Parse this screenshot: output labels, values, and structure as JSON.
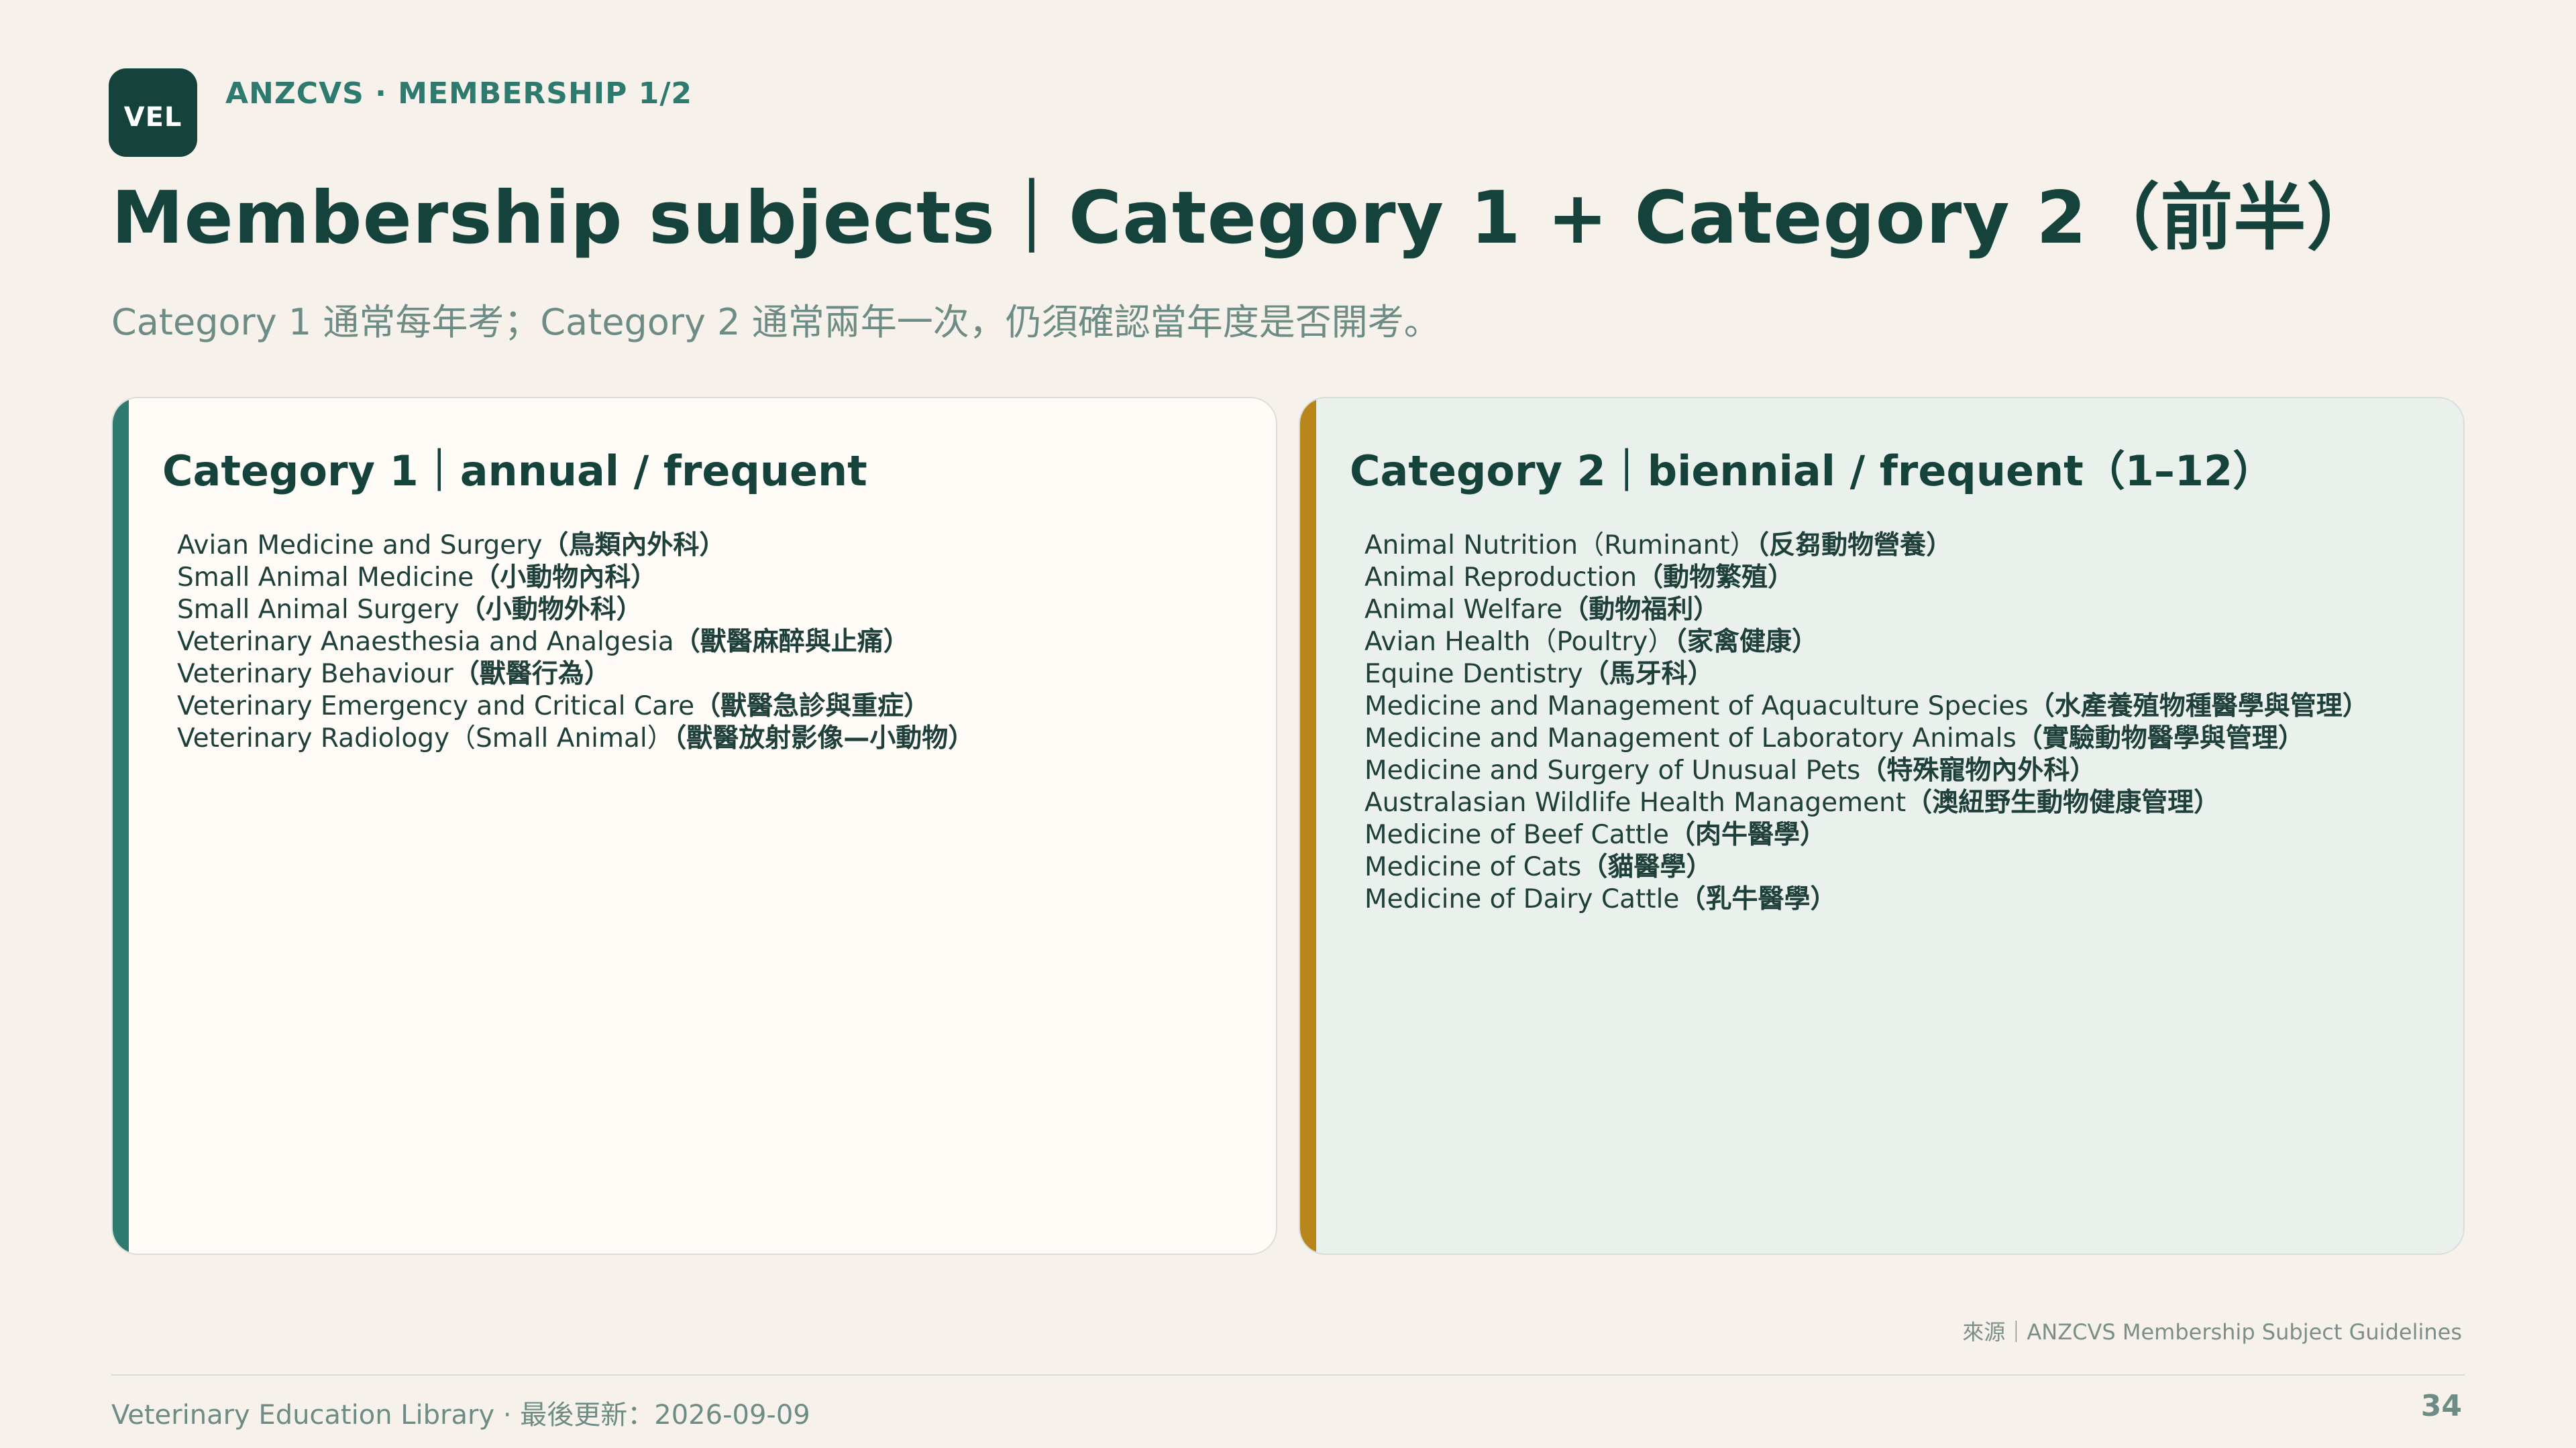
{
  "brand": {
    "logo_text": "VEL",
    "kicker": "ANZCVS · MEMBERSHIP 1/2"
  },
  "title": "Membership subjects｜Category 1 + Category 2（前半）",
  "subtitle": "Category 1 通常每年考；Category 2 通常兩年一次，仍須確認當年度是否開考。",
  "colors": {
    "background": "#F6F2EB",
    "brand_dark": "#15433C",
    "teal_accent": "#2F7A6E",
    "gold_accent": "#B8861B",
    "card1_bg": "#FFFCF8",
    "card2_bg": "#EAF1EC"
  },
  "category1": {
    "title": "Category 1｜annual / frequent",
    "subjects": [
      {
        "en": "Avian Medicine and Surgery",
        "zh": "（鳥類內外科）"
      },
      {
        "en": "Small Animal Medicine",
        "zh": "（小動物內科）"
      },
      {
        "en": "Small Animal Surgery",
        "zh": "（小動物外科）"
      },
      {
        "en": "Veterinary Anaesthesia and Analgesia",
        "zh": "（獸醫麻醉與止痛）"
      },
      {
        "en": "Veterinary Behaviour",
        "zh": "（獸醫行為）"
      },
      {
        "en": "Veterinary Emergency and Critical Care",
        "zh": "（獸醫急診與重症）"
      },
      {
        "en": "Veterinary Radiology（Small Animal）",
        "zh": "（獸醫放射影像—小動物）"
      }
    ]
  },
  "category2": {
    "title": "Category 2｜biennial / frequent（1–12）",
    "subjects": [
      {
        "en": "Animal Nutrition（Ruminant）",
        "zh": "（反芻動物營養）"
      },
      {
        "en": "Animal Reproduction",
        "zh": "（動物繁殖）"
      },
      {
        "en": "Animal Welfare",
        "zh": "（動物福利）"
      },
      {
        "en": "Avian Health（Poultry）",
        "zh": "（家禽健康）"
      },
      {
        "en": "Equine Dentistry",
        "zh": "（馬牙科）"
      },
      {
        "en": "Medicine and Management of Aquaculture Species",
        "zh": "（水產養殖物種醫學與管理）"
      },
      {
        "en": "Medicine and Management of Laboratory Animals",
        "zh": "（實驗動物醫學與管理）"
      },
      {
        "en": "Medicine and Surgery of Unusual Pets",
        "zh": "（特殊寵物內外科）"
      },
      {
        "en": "Australasian Wildlife Health Management",
        "zh": "（澳紐野生動物健康管理）"
      },
      {
        "en": "Medicine of Beef Cattle",
        "zh": "（肉牛醫學）"
      },
      {
        "en": "Medicine of Cats",
        "zh": "（貓醫學）"
      },
      {
        "en": "Medicine of Dairy Cattle",
        "zh": "（乳牛醫學）"
      }
    ]
  },
  "source": "來源｜ANZCVS Membership Subject Guidelines",
  "footer": {
    "text": "Veterinary Education Library · 最後更新：2026-09-09",
    "page_number": "34"
  }
}
